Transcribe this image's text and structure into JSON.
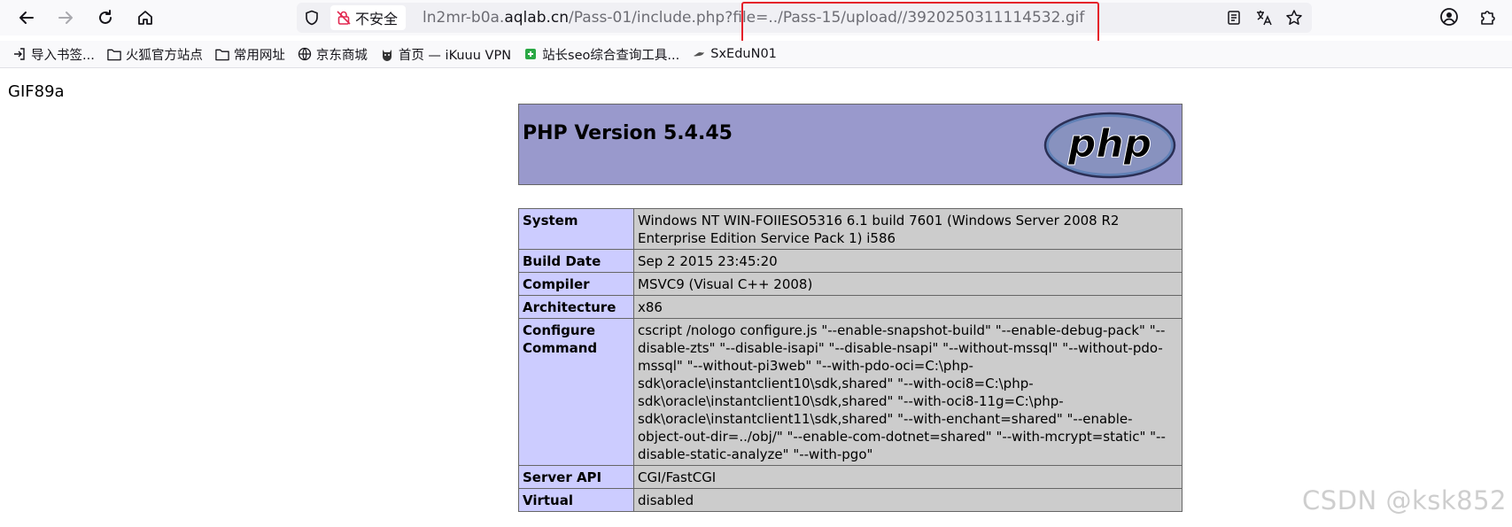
{
  "browser": {
    "security_label": "不安全",
    "url": {
      "host": "ln2mr-b0a.",
      "domain": "aqlab.cn",
      "path": "/Pass-01/include.php?file=../Pass-15/upload//3920250311114532.gif"
    },
    "bookmarks": [
      {
        "label": "导入书签...",
        "icon": "import-icon"
      },
      {
        "label": "火狐官方站点",
        "icon": "folder-icon"
      },
      {
        "label": "常用网址",
        "icon": "folder-icon"
      },
      {
        "label": "京东商城",
        "icon": "globe-icon"
      },
      {
        "label": "首页 — iKuuu VPN",
        "icon": "cat-icon"
      },
      {
        "label": "站长seo综合查询工具...",
        "icon": "puzzle-icon"
      },
      {
        "label": "SxEduN01",
        "icon": "bird-icon"
      }
    ]
  },
  "page": {
    "gif_header": "GIF89a",
    "php_version_title": "PHP Version 5.4.45",
    "logo_text": "php",
    "rows": [
      {
        "key": "System",
        "value": "Windows NT WIN-FOIIESO5316 6.1 build 7601 (Windows Server 2008 R2 Enterprise Edition Service Pack 1) i586"
      },
      {
        "key": "Build Date",
        "value": "Sep 2 2015 23:45:20"
      },
      {
        "key": "Compiler",
        "value": "MSVC9 (Visual C++ 2008)"
      },
      {
        "key": "Architecture",
        "value": "x86"
      },
      {
        "key": "Configure Command",
        "value": "cscript /nologo configure.js \"--enable-snapshot-build\" \"--enable-debug-pack\" \"--disable-zts\" \"--disable-isapi\" \"--disable-nsapi\" \"--without-mssql\" \"--without-pdo-mssql\" \"--without-pi3web\" \"--with-pdo-oci=C:\\php-sdk\\oracle\\instantclient10\\sdk,shared\" \"--with-oci8=C:\\php-sdk\\oracle\\instantclient10\\sdk,shared\" \"--with-oci8-11g=C:\\php-sdk\\oracle\\instantclient11\\sdk,shared\" \"--with-enchant=shared\" \"--enable-object-out-dir=../obj/\" \"--enable-com-dotnet=shared\" \"--with-mcrypt=static\" \"--disable-static-analyze\" \"--with-pgo\""
      },
      {
        "key": "Server API",
        "value": "CGI/FastCGI"
      },
      {
        "key": "Virtual",
        "value": "disabled"
      }
    ]
  },
  "watermark": "CSDN @ksk852",
  "colors": {
    "highlight": "#e5202a",
    "php_header_bg": "#9999cc",
    "key_cell_bg": "#ccccff",
    "value_cell_bg": "#cccccc"
  }
}
